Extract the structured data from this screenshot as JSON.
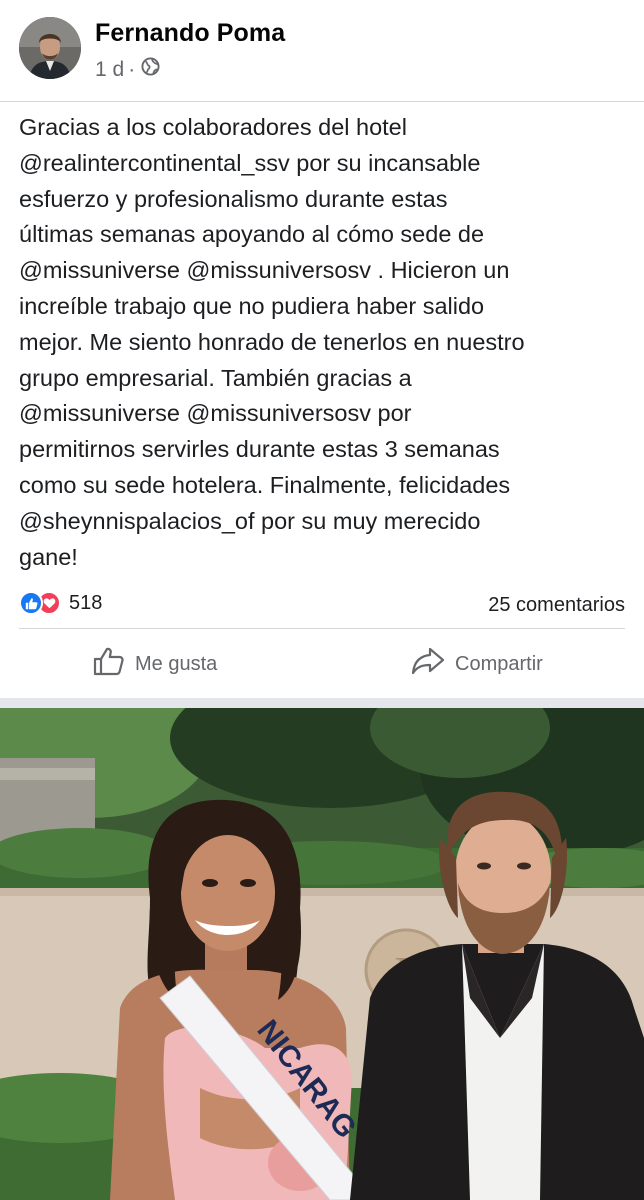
{
  "post": {
    "author": "Fernando Poma",
    "time": "1 d",
    "separator_dot": "·",
    "privacy_icon": "globe-icon",
    "text": "Gracias a los colaboradores del hotel\n@realintercontinental_ssv por su incansable\nesfuerzo y profesionalismo durante estas\núltimas semanas apoyando al cómo sede de\n@missuniverse @missuniversosv .  Hicieron un\nincreíble trabajo que no pudiera haber salido\nmejor.  Me siento honrado de tenerlos en nuestro\ngrupo empresarial. También gracias a\n@missuniverse @missuniversosv por\npermitirnos servirles durante estas 3 semanas\ncomo su sede hotelera.  Finalmente, felicidades\n@sheynnispalacios_of  por su muy merecido\ngane!"
  },
  "stats": {
    "reaction_icons": [
      "like-icon",
      "love-icon"
    ],
    "reaction_count": "518",
    "comments": "25 comentarios"
  },
  "actions": {
    "like_label": "Me gusta",
    "share_label": "Compartir"
  },
  "photo": {
    "sash_text": "NICARAG"
  },
  "colors": {
    "like_blue": "#1877f2",
    "love_red": "#f33e58",
    "secondary_text": "#65676b"
  }
}
